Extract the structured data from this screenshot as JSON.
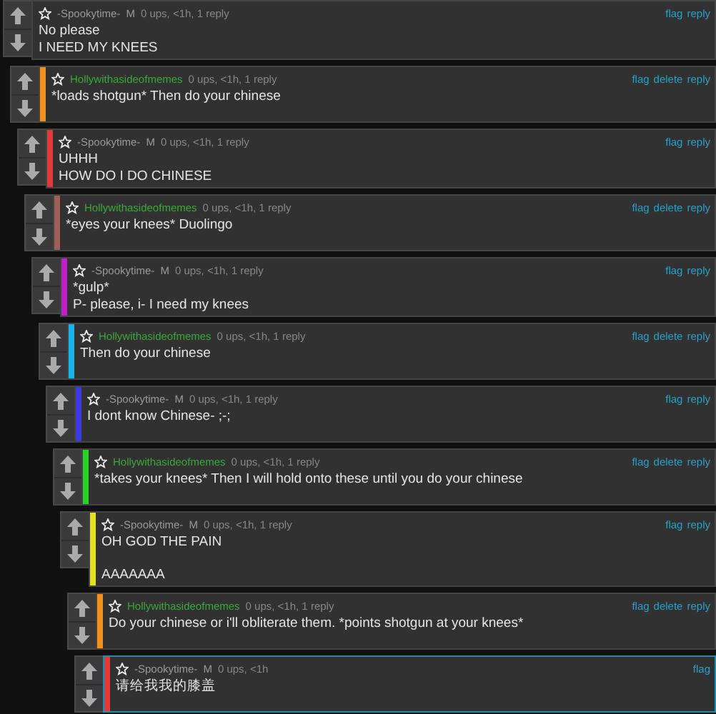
{
  "thread": {
    "user": "-Spookytime-",
    "badge": "M",
    "meta": "0 ups, <1h, 1 reply",
    "kind": "moderator",
    "actions": [
      "flag",
      "reply"
    ],
    "body": [
      [
        "No please",
        "I NEED MY KNEES"
      ]
    ],
    "highlighted": false,
    "children": [
      {
        "user": "Hollywithasideofmemes",
        "meta": "0 ups, <1h, 1 reply",
        "kind": "member",
        "color": "#f0901c",
        "actions": [
          "flag",
          "delete",
          "reply"
        ],
        "body": [
          [
            "*loads shotgun* Then do your chinese"
          ]
        ],
        "highlighted": false,
        "children": [
          {
            "user": "-Spookytime-",
            "badge": "M",
            "meta": "0 ups, <1h, 1 reply",
            "kind": "moderator",
            "color": "#e03a3a",
            "actions": [
              "flag",
              "reply"
            ],
            "body": [
              [
                "UHHH",
                "HOW DO I DO CHINESE"
              ]
            ],
            "highlighted": false,
            "children": [
              {
                "user": "Hollywithasideofmemes",
                "meta": "0 ups, <1h, 1 reply",
                "kind": "member",
                "color": "#a0605a",
                "actions": [
                  "flag",
                  "delete",
                  "reply"
                ],
                "body": [
                  [
                    "*eyes your knees* Duolingo"
                  ]
                ],
                "highlighted": false,
                "children": [
                  {
                    "user": "-Spookytime-",
                    "badge": "M",
                    "meta": "0 ups, <1h, 1 reply",
                    "kind": "moderator",
                    "color": "#c020c8",
                    "actions": [
                      "flag",
                      "reply"
                    ],
                    "body": [
                      [
                        "*gulp*",
                        "P- please, i- I need my knees"
                      ]
                    ],
                    "highlighted": false,
                    "children": [
                      {
                        "user": "Hollywithasideofmemes",
                        "meta": "0 ups, <1h, 1 reply",
                        "kind": "member",
                        "color": "#1ab0e8",
                        "actions": [
                          "flag",
                          "delete",
                          "reply"
                        ],
                        "body": [
                          [
                            "Then do your chinese"
                          ]
                        ],
                        "highlighted": false,
                        "children": [
                          {
                            "user": "-Spookytime-",
                            "badge": "M",
                            "meta": "0 ups, <1h, 1 reply",
                            "kind": "moderator",
                            "color": "#3a3ae0",
                            "actions": [
                              "flag",
                              "reply"
                            ],
                            "body": [
                              [
                                "I dont know Chinese- ;-;"
                              ]
                            ],
                            "highlighted": false,
                            "children": [
                              {
                                "user": "Hollywithasideofmemes",
                                "meta": "0 ups, <1h, 1 reply",
                                "kind": "member",
                                "color": "#28d028",
                                "actions": [
                                  "flag",
                                  "delete",
                                  "reply"
                                ],
                                "body": [
                                  [
                                    "*takes your knees* Then I will hold onto these until you do your chinese"
                                  ]
                                ],
                                "highlighted": false,
                                "children": [
                                  {
                                    "user": "-Spookytime-",
                                    "badge": "M",
                                    "meta": "0 ups, <1h, 1 reply",
                                    "kind": "moderator",
                                    "color": "#e0e020",
                                    "actions": [
                                      "flag",
                                      "reply"
                                    ],
                                    "body": [
                                      [
                                        "OH GOD THE PAIN"
                                      ],
                                      [
                                        "AAAAAAA"
                                      ]
                                    ],
                                    "highlighted": false,
                                    "children": [
                                      {
                                        "user": "Hollywithasideofmemes",
                                        "meta": "0 ups, <1h, 1 reply",
                                        "kind": "member",
                                        "color": "#f0901c",
                                        "actions": [
                                          "flag",
                                          "delete",
                                          "reply"
                                        ],
                                        "body": [
                                          [
                                            "Do your chinese or i'll obliterate them. *points shotgun at your knees*"
                                          ]
                                        ],
                                        "highlighted": false,
                                        "children": [
                                          {
                                            "user": "-Spookytime-",
                                            "badge": "M",
                                            "meta": "0 ups, <1h",
                                            "kind": "moderator",
                                            "color": "#e03a3a",
                                            "actions": [
                                              "flag"
                                            ],
                                            "body": [
                                              [
                                                "请给我我的膝盖"
                                              ]
                                            ],
                                            "highlighted": true
                                          }
                                        ]
                                      }
                                    ]
                                  }
                                ]
                              }
                            ]
                          }
                        ]
                      }
                    ]
                  }
                ]
              }
            ]
          }
        ]
      }
    ]
  }
}
